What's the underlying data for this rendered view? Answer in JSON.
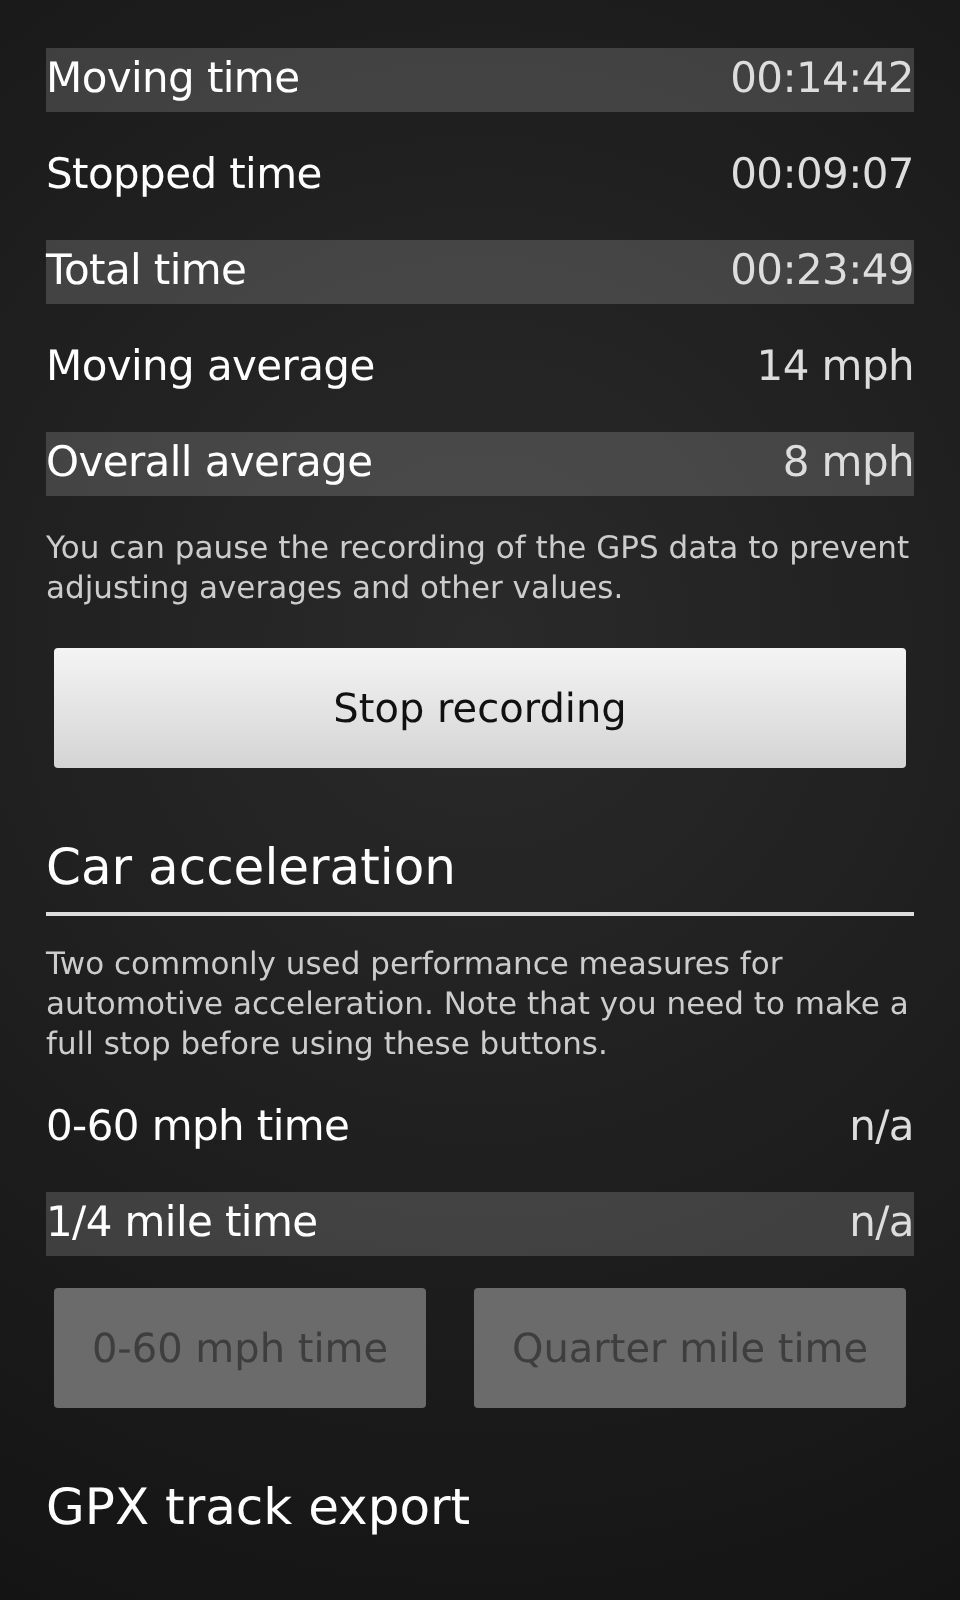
{
  "stats": [
    {
      "label": "Moving time",
      "value": "00:14:42",
      "shaded": true
    },
    {
      "label": "Stopped time",
      "value": "00:09:07",
      "shaded": false
    },
    {
      "label": "Total time",
      "value": "00:23:49",
      "shaded": true
    },
    {
      "label": "Moving average",
      "value": "14 mph",
      "shaded": false
    },
    {
      "label": "Overall average",
      "value": "8 mph",
      "shaded": true
    }
  ],
  "recording": {
    "note": "You can pause the recording of the GPS data to prevent adjusting averages and other values.",
    "button": {
      "label": "Stop recording",
      "disabled": false
    }
  },
  "acceleration": {
    "title": "Car acceleration",
    "note": "Two commonly used performance measures for automotive acceleration. Note that you need to make a full stop before using these buttons.",
    "rows": [
      {
        "label": "0-60 mph time",
        "value": "n/a",
        "shaded": false
      },
      {
        "label": "1/4 mile time",
        "value": "n/a",
        "shaded": true
      }
    ],
    "buttons": [
      {
        "label": "0-60 mph time",
        "disabled": true
      },
      {
        "label": "Quarter mile time",
        "disabled": true
      }
    ]
  },
  "export": {
    "title": "GPX track export"
  }
}
